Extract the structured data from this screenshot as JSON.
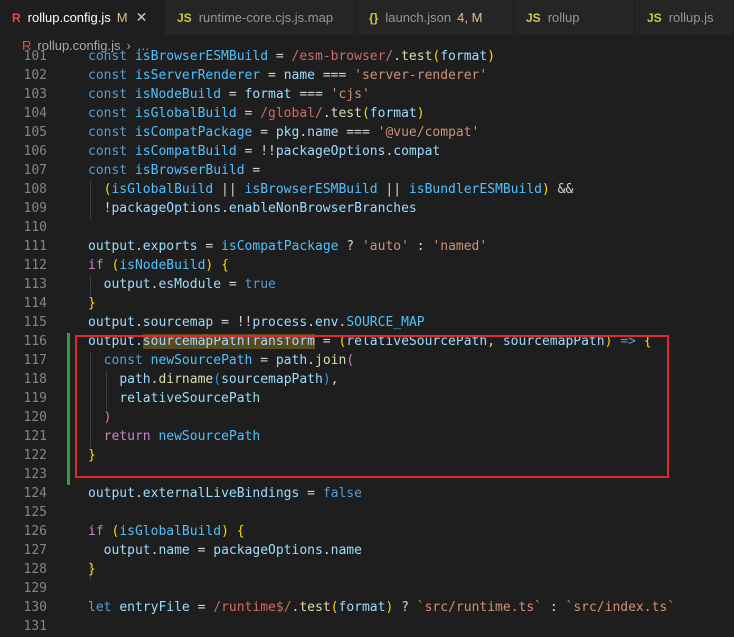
{
  "tabs": [
    {
      "label": "rollup.config.js",
      "icon": "rollup-icon",
      "status": "M",
      "active": true
    },
    {
      "label": "runtime-core.cjs.js.map",
      "icon": "js-file-icon",
      "status": "",
      "active": false
    },
    {
      "label": "launch.json",
      "icon": "json-file-icon",
      "status": "4, M",
      "active": false
    },
    {
      "label": "rollup",
      "icon": "js-file-icon",
      "status": "",
      "active": false
    },
    {
      "label": "rollup.js",
      "icon": "js-file-icon",
      "status": "",
      "active": false
    }
  ],
  "breadcrumb": {
    "file": "rollup.config.js",
    "rest": "…"
  },
  "editor": {
    "first_line": 101,
    "colors": {
      "background": "#1e1e1e",
      "highlight_box": "#e0282e",
      "modified_gutter": "#2ea043"
    }
  }
}
